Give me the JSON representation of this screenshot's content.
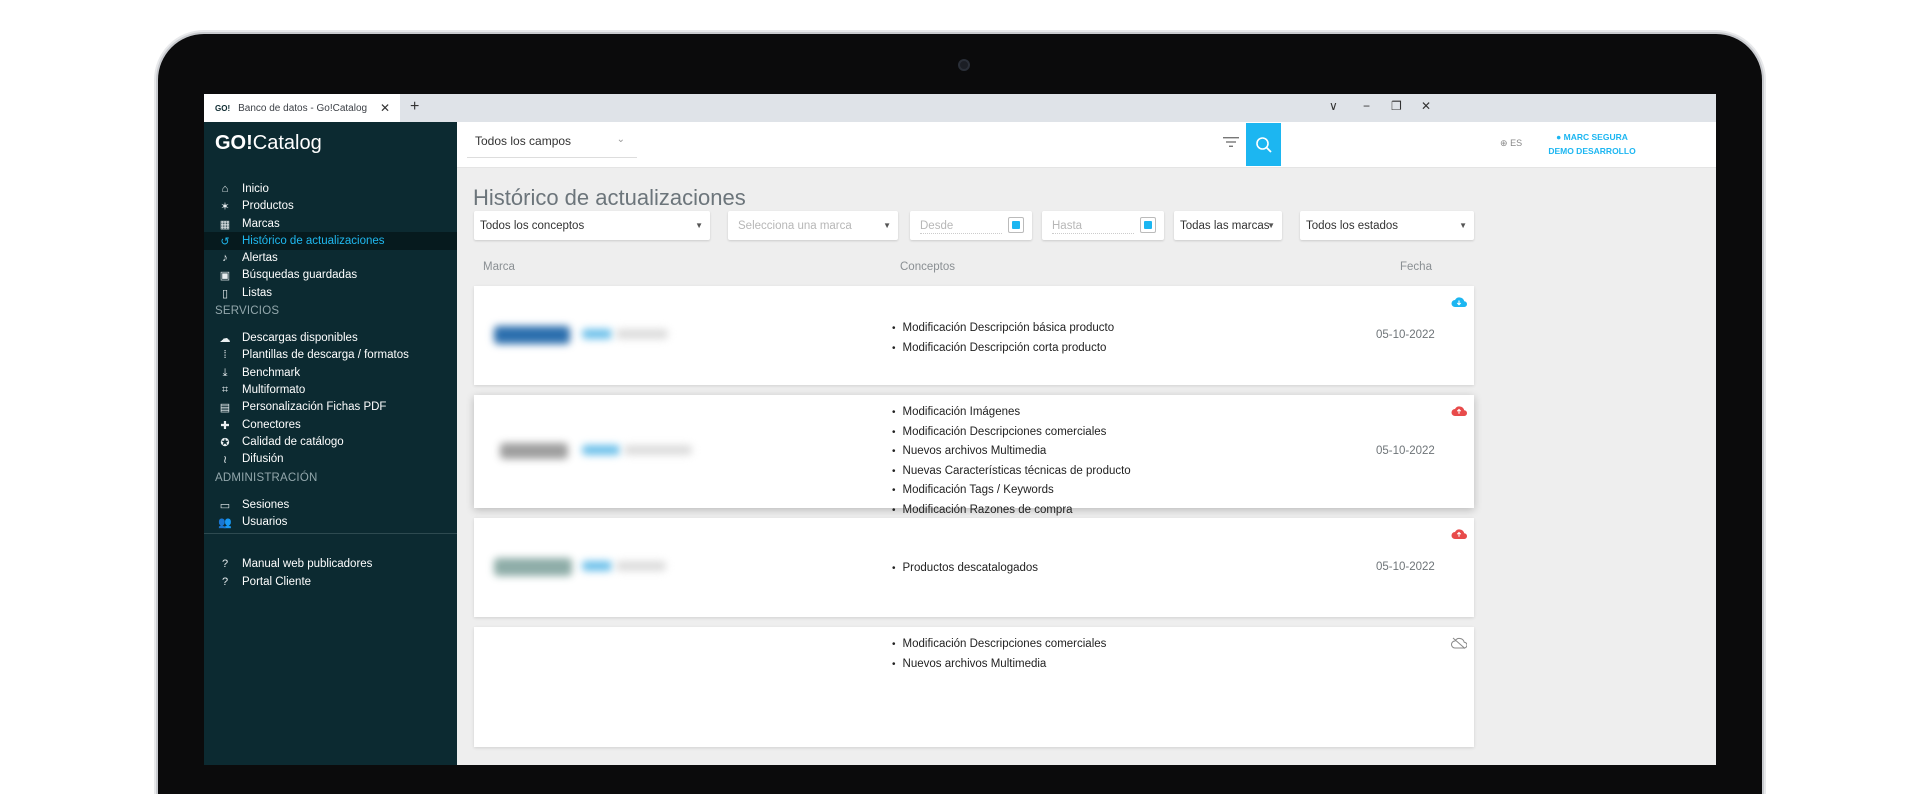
{
  "browser": {
    "tab_favicon": "GO!",
    "tab_title": "Banco de datos - Go!Catalog",
    "tab_close": "✕",
    "new_tab": "+",
    "controls": [
      "∨",
      "−",
      "❐",
      "✕"
    ]
  },
  "app": {
    "logo_bold": "GO!",
    "logo_rest": "Catalog"
  },
  "sidebar": {
    "items": [
      {
        "label": "Inicio",
        "icon": "home-icon"
      },
      {
        "label": "Productos",
        "icon": "product-icon"
      },
      {
        "label": "Marcas",
        "icon": "grid-icon"
      },
      {
        "label": "Histórico de actualizaciones",
        "icon": "history-icon",
        "active": true
      },
      {
        "label": "Alertas",
        "icon": "bell-icon"
      },
      {
        "label": "Búsquedas guardadas",
        "icon": "saved-search-icon"
      },
      {
        "label": "Listas",
        "icon": "bookmark-icon"
      }
    ],
    "services_title": "SERVICIOS",
    "services": [
      {
        "label": "Descargas disponibles",
        "icon": "cloud-download-icon"
      },
      {
        "label": "Plantillas de descarga / formatos",
        "icon": "grid-icon"
      },
      {
        "label": "Benchmark",
        "icon": "download-icon"
      },
      {
        "label": "Multiformato",
        "icon": "crop-icon"
      },
      {
        "label": "Personalización Fichas PDF",
        "icon": "image-icon"
      },
      {
        "label": "Conectores",
        "icon": "puzzle-icon"
      },
      {
        "label": "Calidad de catálogo",
        "icon": "star-icon"
      },
      {
        "label": "Difusión",
        "icon": "rss-icon"
      }
    ],
    "admin_title": "ADMINISTRACIÓN",
    "admin": [
      {
        "label": "Sesiones",
        "icon": "devices-icon"
      },
      {
        "label": "Usuarios",
        "icon": "users-icon"
      }
    ],
    "help": [
      {
        "label": "Manual web publicadores",
        "icon": "help-icon"
      },
      {
        "label": "Portal Cliente",
        "icon": "help-icon"
      }
    ]
  },
  "topbar": {
    "field_select": "Todos los campos",
    "lang": "ES",
    "user_name": "MARC SEGURA",
    "user_org": "DEMO DESARROLLO"
  },
  "page": {
    "title": "Histórico de actualizaciones",
    "filters": {
      "concepts": "Todos los conceptos",
      "brand_placeholder": "Selecciona una marca",
      "from_placeholder": "Desde",
      "to_placeholder": "Hasta",
      "brands": "Todas las marcas",
      "states": "Todos los estados"
    },
    "columns": {
      "brand": "Marca",
      "concepts": "Conceptos",
      "date": "Fecha"
    }
  },
  "rows": [
    {
      "concepts": [
        "Modificación Descripción básica producto",
        "Modificación Descripción corta producto"
      ],
      "date": "05-10-2022",
      "status_color": "#1cb6f1",
      "status_icon": "cloud-icon"
    },
    {
      "concepts": [
        "Modificación Imágenes",
        "Modificación Descripciones comerciales",
        "Nuevos archivos Multimedia",
        "Nuevas Características técnicas de producto",
        "Modificación Tags / Keywords",
        "Modificación Razones de compra"
      ],
      "date": "05-10-2022",
      "status_color": "#e84b4b",
      "status_icon": "cloud-icon"
    },
    {
      "concepts": [
        "Productos descatalogados"
      ],
      "date": "05-10-2022",
      "status_color": "#e84b4b",
      "status_icon": "cloud-icon"
    },
    {
      "concepts": [
        "Modificación Descripciones comerciales",
        "Nuevos archivos Multimedia"
      ],
      "date": "",
      "status_color": "#888888",
      "status_icon": "cloud-off-icon"
    }
  ]
}
